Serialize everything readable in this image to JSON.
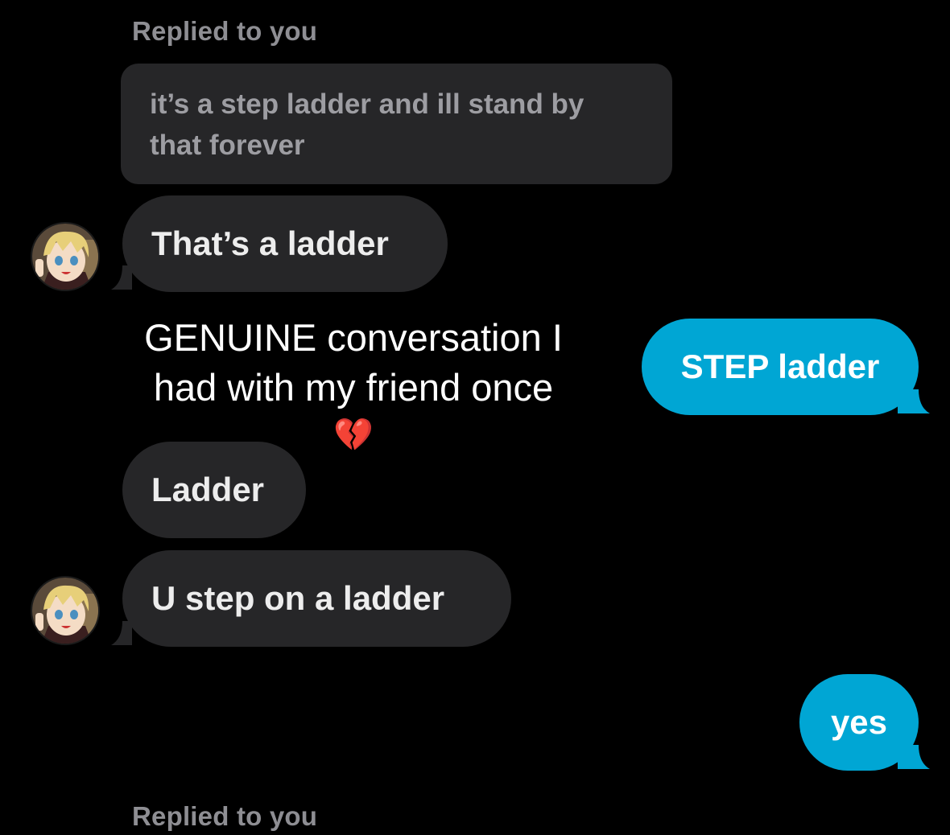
{
  "colors": {
    "background": "#000000",
    "incoming_bubble": "#262628",
    "outgoing_bubble": "#00a6d4",
    "reply_label": "#8e8e93"
  },
  "reply_label_top": "Replied to you",
  "reply_label_bottom": "Replied to you",
  "quoted_message": "it’s a step ladder and ill stand by that forever",
  "messages": [
    {
      "side": "incoming",
      "text": "That’s a ladder",
      "avatar": "anime-avatar-icon"
    },
    {
      "side": "outgoing",
      "text": "STEP ladder"
    },
    {
      "side": "incoming",
      "text": "Ladder"
    },
    {
      "side": "incoming",
      "text": "U step on a ladder",
      "avatar": "anime-avatar-icon"
    },
    {
      "side": "outgoing",
      "text": "yes"
    }
  ],
  "overlay_caption": {
    "line1": "GENUINE conversation I",
    "line2": "had with my friend once",
    "emoji": "💔"
  }
}
